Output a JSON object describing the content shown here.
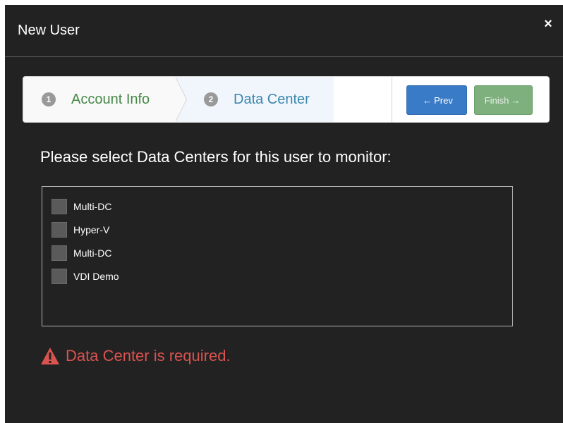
{
  "modal": {
    "title": "New User",
    "close_symbol": "×"
  },
  "wizard": {
    "steps": [
      {
        "number": "1",
        "label": "Account Info",
        "state": "complete"
      },
      {
        "number": "2",
        "label": "Data Center",
        "state": "active"
      }
    ],
    "prev_label": "Prev",
    "finish_label": "Finish",
    "prev_arrow": "←",
    "finish_arrow": "→"
  },
  "prompt": "Please select Data Centers for this user to monitor:",
  "data_centers": [
    {
      "label": "Multi-DC",
      "checked": false
    },
    {
      "label": "Hyper-V",
      "checked": false
    },
    {
      "label": "Multi-DC",
      "checked": false
    },
    {
      "label": "VDI Demo",
      "checked": false
    }
  ],
  "error": {
    "message": "Data Center is required.",
    "icon": "warning-icon"
  },
  "colors": {
    "modal_bg": "#222222",
    "step_complete": "#468847",
    "step_active": "#3a87ad",
    "prev_button": "#3a7bc7",
    "finish_button": "#7eb07e",
    "error": "#d9534f"
  }
}
